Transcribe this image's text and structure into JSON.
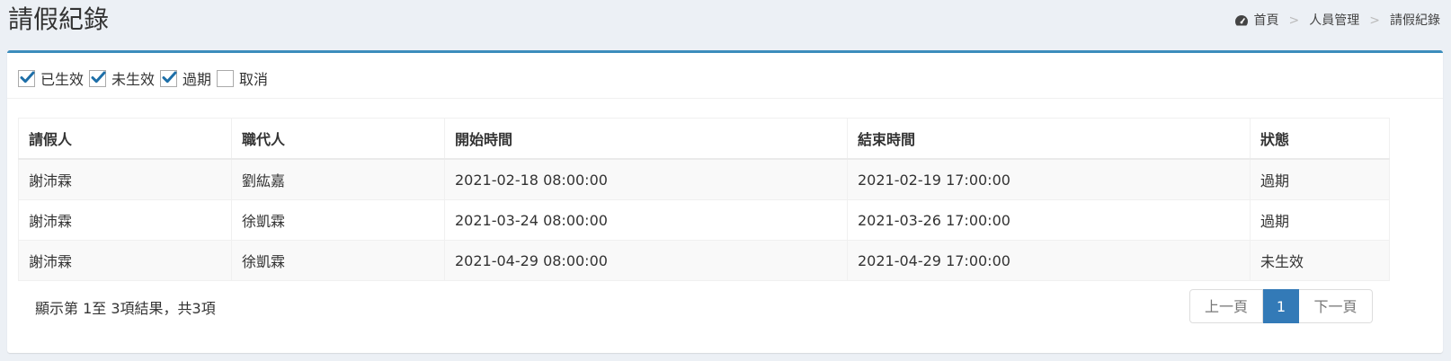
{
  "header": {
    "title": "請假紀錄",
    "breadcrumb": [
      "首頁",
      "人員管理",
      "請假紀錄"
    ]
  },
  "filters": [
    {
      "label": "已生效",
      "checked": true
    },
    {
      "label": "未生效",
      "checked": true
    },
    {
      "label": "過期",
      "checked": true
    },
    {
      "label": "取消",
      "checked": false
    }
  ],
  "table": {
    "columns": [
      "請假人",
      "職代人",
      "開始時間",
      "結束時間",
      "狀態"
    ],
    "rows": [
      [
        "謝沛霖",
        "劉紘嘉",
        "2021-02-18 08:00:00",
        "2021-02-19 17:00:00",
        "過期"
      ],
      [
        "謝沛霖",
        "徐凱霖",
        "2021-03-24 08:00:00",
        "2021-03-26 17:00:00",
        "過期"
      ],
      [
        "謝沛霖",
        "徐凱霖",
        "2021-04-29 08:00:00",
        "2021-04-29 17:00:00",
        "未生效"
      ]
    ]
  },
  "footer": {
    "info": "顯示第 1至 3項結果，共3項",
    "prev": "上一頁",
    "page": "1",
    "next": "下一頁"
  },
  "colors": {
    "accent": "#3c8dbc",
    "active_page": "#337ab7",
    "check": "#1e6fa8"
  }
}
